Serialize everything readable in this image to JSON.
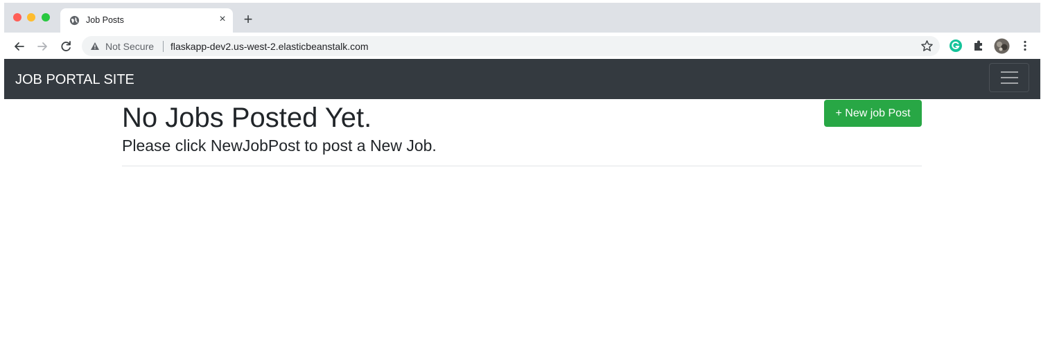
{
  "browser": {
    "tab_title": "Job Posts",
    "new_tab_symbol": "+",
    "close_symbol": "×",
    "security_label": "Not Secure",
    "url": "flaskapp-dev2.us-west-2.elasticbeanstalk.com",
    "icons": [
      "back-icon",
      "forward-icon",
      "reload-icon",
      "warning-icon",
      "star-icon",
      "grammarly-icon",
      "extensions-icon",
      "profile-avatar",
      "menu-icon",
      "globe-icon"
    ]
  },
  "navbar": {
    "brand": "JOB PORTAL SITE",
    "background": "#343a40"
  },
  "main": {
    "heading": "No Jobs Posted Yet.",
    "subheading": "Please click NewJobPost to post a New Job.",
    "new_button_label": "+ New job Post",
    "button_color": "#28a745"
  }
}
